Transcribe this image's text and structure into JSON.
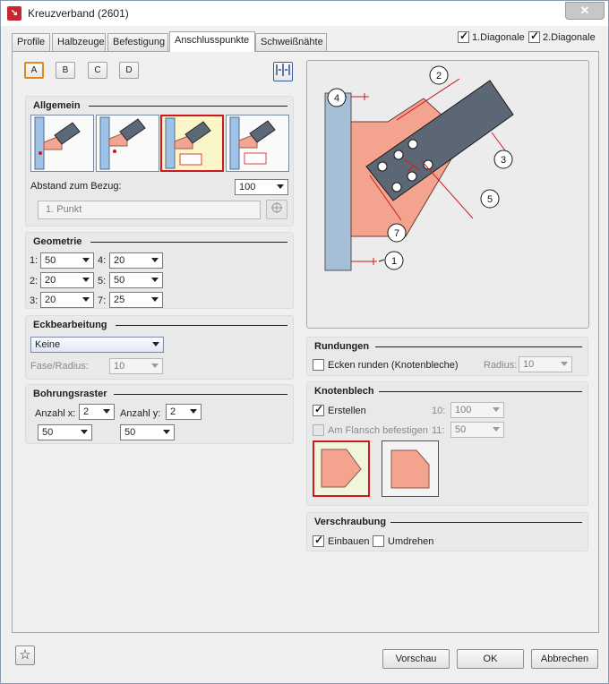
{
  "window": {
    "title": "Kreuzverband (2601)",
    "close": "✕"
  },
  "tabs": [
    "Profile",
    "Halbzeuge",
    "Befestigung",
    "Anschlusspunkte",
    "Schweißnähte"
  ],
  "diagonals": {
    "d1": "1.Diagonale",
    "d2": "2.Diagonale"
  },
  "points": [
    "A",
    "B",
    "C",
    "D"
  ],
  "allgemein": {
    "title": "Allgemein",
    "abstand_label": "Abstand zum Bezug:",
    "abstand_value": "100",
    "punkt": "1. Punkt"
  },
  "geometrie": {
    "title": "Geometrie",
    "rows": [
      {
        "l1": "1:",
        "v1": "50",
        "l2": "4:",
        "v2": "20"
      },
      {
        "l1": "2:",
        "v1": "20",
        "l2": "5:",
        "v2": "50"
      },
      {
        "l1": "3:",
        "v1": "20",
        "l2": "7:",
        "v2": "25"
      }
    ]
  },
  "eck": {
    "title": "Eckbearbeitung",
    "value": "Keine",
    "fase_label": "Fase/Radius:",
    "fase_value": "10"
  },
  "bohr": {
    "title": "Bohrungsraster",
    "ax_label": "Anzahl x:",
    "ax_value": "2",
    "ay_label": "Anzahl y:",
    "ay_value": "2",
    "sx": "50",
    "sy": "50"
  },
  "diagram": {
    "labels": [
      "1",
      "2",
      "3",
      "4",
      "5",
      "7"
    ]
  },
  "rund": {
    "title": "Rundungen",
    "ecken": "Ecken runden (Knotenbleche)",
    "radius_label": "Radius:",
    "radius_value": "10"
  },
  "knoten": {
    "title": "Knotenblech",
    "erstellen": "Erstellen",
    "flansch": "Am Flansch befestigen",
    "l10": "10:",
    "v10": "100",
    "l11": "11:",
    "v11": "50"
  },
  "versch": {
    "title": "Verschraubung",
    "einbauen": "Einbauen",
    "umdrehen": "Umdrehen"
  },
  "buttons": {
    "vorschau": "Vorschau",
    "ok": "OK",
    "abbrechen": "Abbrechen",
    "star": "☆"
  }
}
